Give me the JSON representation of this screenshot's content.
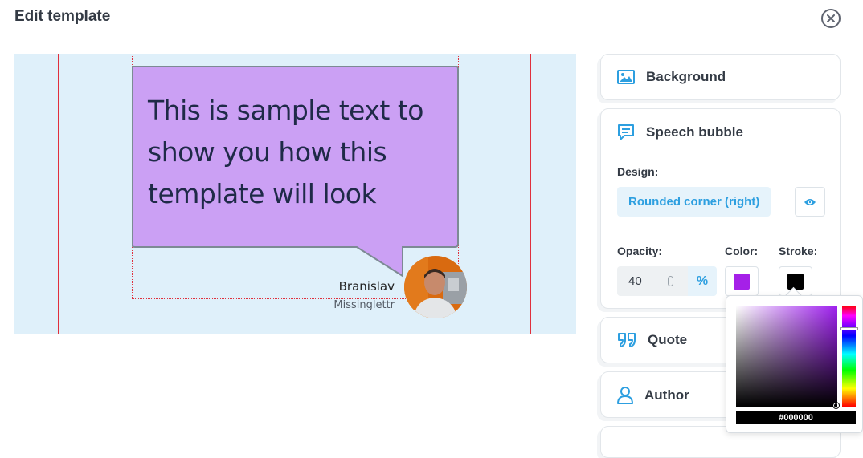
{
  "dialog": {
    "title": "Edit template"
  },
  "preview": {
    "bubble_text": "This is sample text to show you how this template will look",
    "bubble_color": "#cba0f4",
    "author_name": "Branislav",
    "author_company": "Missinglettr"
  },
  "panels": {
    "background": {
      "label": "Background",
      "icon": "image-icon"
    },
    "speech_bubble": {
      "label": "Speech bubble",
      "icon": "speech-bubble-icon",
      "design_label": "Design:",
      "design_value": "Rounded corner (right)",
      "opacity_label": "Opacity:",
      "opacity_value": "40",
      "opacity_unit": "%",
      "color_label": "Color:",
      "color_value": "#a520e8",
      "stroke_label": "Stroke:",
      "stroke_value": "#000000"
    },
    "quote": {
      "label": "Quote",
      "icon": "quote-icon"
    },
    "author": {
      "label": "Author",
      "icon": "user-icon"
    }
  },
  "color_picker": {
    "hex": "#000000",
    "hue_color": "#a020f0"
  },
  "colors": {
    "accent": "#2d9fe0",
    "guide": "#e0303c",
    "canvas_bg": "#dff0fa"
  }
}
